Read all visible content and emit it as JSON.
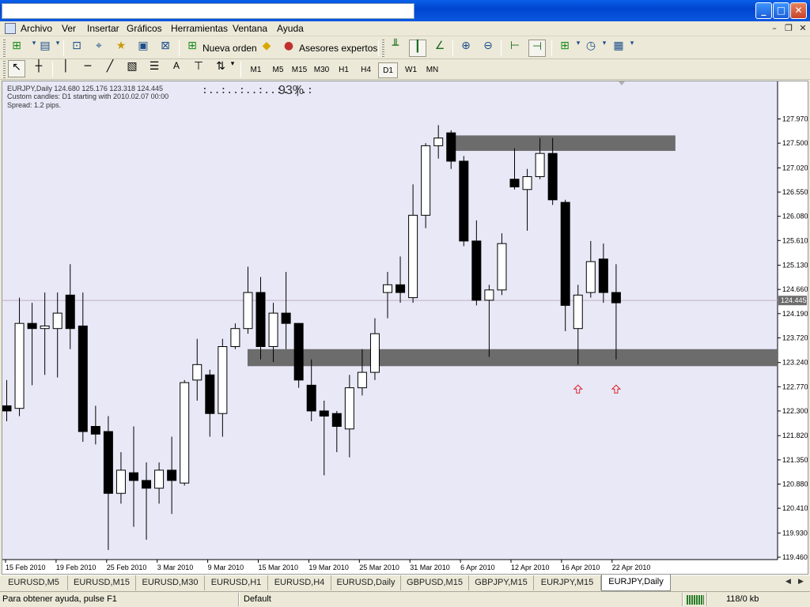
{
  "menu": {
    "items": [
      "Archivo",
      "Ver",
      "Insertar",
      "Gráficos",
      "Herramientas",
      "Ventana",
      "Ayuda"
    ]
  },
  "toolbar": {
    "new_order": "Nueva orden",
    "expert_advisors": "Asesores expertos",
    "timeframes": [
      "M1",
      "M5",
      "M15",
      "M30",
      "H1",
      "H4",
      "D1",
      "W1",
      "MN"
    ],
    "active_timeframe": "D1"
  },
  "chart": {
    "header_line1": "EURJPY,Daily  124.680 125.176 123.318 124.445",
    "header_line2": "Custom candles: D1 starting with 2010.02.07 00:00",
    "header_line3": "Spread:  1.2 pips.",
    "progress_text": ":..:..:..:..:..|.:",
    "progress_percent": "93%",
    "current_price_label": "124.445"
  },
  "chart_data": {
    "type": "candlestick",
    "symbol": "EURJPY",
    "timeframe": "Daily",
    "ylim": [
      119.46,
      128.3
    ],
    "y_ticks": [
      "127.970",
      "127.500",
      "127.020",
      "126.550",
      "126.080",
      "125.610",
      "125.130",
      "124.660",
      "124.190",
      "123.720",
      "123.240",
      "122.770",
      "122.300",
      "121.820",
      "121.350",
      "120.880",
      "120.410",
      "119.930",
      "119.460"
    ],
    "x_tick_labels": [
      "15 Feb 2010",
      "19 Feb 2010",
      "25 Feb 2010",
      "3 Mar 2010",
      "9 Mar 2010",
      "15 Mar 2010",
      "19 Mar 2010",
      "25 Mar 2010",
      "31 Mar 2010",
      "6 Apr 2010",
      "12 Apr 2010",
      "16 Apr 2010",
      "22 Apr 2010"
    ],
    "last_price": 124.445,
    "candles": [
      {
        "o": 122.4,
        "h": 122.9,
        "l": 122.1,
        "c": 122.3
      },
      {
        "o": 122.35,
        "h": 124.5,
        "l": 122.2,
        "c": 124.0
      },
      {
        "o": 124.0,
        "h": 124.4,
        "l": 122.8,
        "c": 123.9
      },
      {
        "o": 123.9,
        "h": 124.6,
        "l": 123.0,
        "c": 123.95
      },
      {
        "o": 123.9,
        "h": 124.6,
        "l": 122.95,
        "c": 124.2
      },
      {
        "o": 124.55,
        "h": 125.15,
        "l": 123.5,
        "c": 123.9
      },
      {
        "o": 123.95,
        "h": 124.6,
        "l": 121.7,
        "c": 121.9
      },
      {
        "o": 122.0,
        "h": 122.4,
        "l": 121.65,
        "c": 121.85
      },
      {
        "o": 121.9,
        "h": 122.2,
        "l": 119.6,
        "c": 120.7
      },
      {
        "o": 120.7,
        "h": 121.5,
        "l": 120.5,
        "c": 121.15
      },
      {
        "o": 121.1,
        "h": 122.0,
        "l": 120.05,
        "c": 120.95
      },
      {
        "o": 120.95,
        "h": 121.3,
        "l": 119.8,
        "c": 120.8
      },
      {
        "o": 120.8,
        "h": 121.3,
        "l": 120.5,
        "c": 121.15
      },
      {
        "o": 121.15,
        "h": 121.8,
        "l": 120.3,
        "c": 120.95
      },
      {
        "o": 120.9,
        "h": 122.9,
        "l": 120.85,
        "c": 122.85
      },
      {
        "o": 122.9,
        "h": 123.7,
        "l": 122.5,
        "c": 123.2
      },
      {
        "o": 123.0,
        "h": 123.1,
        "l": 121.8,
        "c": 122.25
      },
      {
        "o": 122.25,
        "h": 123.7,
        "l": 121.8,
        "c": 123.55
      },
      {
        "o": 123.55,
        "h": 124.0,
        "l": 123.5,
        "c": 123.9
      },
      {
        "o": 123.9,
        "h": 125.1,
        "l": 123.8,
        "c": 124.6
      },
      {
        "o": 124.6,
        "h": 124.9,
        "l": 123.3,
        "c": 123.55
      },
      {
        "o": 123.55,
        "h": 124.4,
        "l": 123.25,
        "c": 124.2
      },
      {
        "o": 124.2,
        "h": 125.0,
        "l": 123.5,
        "c": 124.0
      },
      {
        "o": 124.0,
        "h": 124.0,
        "l": 122.75,
        "c": 122.9
      },
      {
        "o": 122.8,
        "h": 123.3,
        "l": 122.1,
        "c": 122.3
      },
      {
        "o": 122.3,
        "h": 122.5,
        "l": 121.05,
        "c": 122.2
      },
      {
        "o": 122.25,
        "h": 122.3,
        "l": 121.5,
        "c": 122.0
      },
      {
        "o": 121.95,
        "h": 123.0,
        "l": 121.4,
        "c": 122.75
      },
      {
        "o": 122.75,
        "h": 123.5,
        "l": 122.6,
        "c": 123.05
      },
      {
        "o": 123.05,
        "h": 124.1,
        "l": 122.9,
        "c": 123.8
      },
      {
        "o": 124.6,
        "h": 125.0,
        "l": 124.1,
        "c": 124.75
      },
      {
        "o": 124.75,
        "h": 125.3,
        "l": 124.4,
        "c": 124.6
      },
      {
        "o": 124.5,
        "h": 126.7,
        "l": 124.4,
        "c": 126.1
      },
      {
        "o": 126.1,
        "h": 127.5,
        "l": 125.85,
        "c": 127.45
      },
      {
        "o": 127.45,
        "h": 127.85,
        "l": 127.2,
        "c": 127.6
      },
      {
        "o": 127.7,
        "h": 127.75,
        "l": 127.0,
        "c": 127.15
      },
      {
        "o": 127.15,
        "h": 127.25,
        "l": 125.5,
        "c": 125.6
      },
      {
        "o": 125.6,
        "h": 126.0,
        "l": 124.35,
        "c": 124.45
      },
      {
        "o": 124.45,
        "h": 124.75,
        "l": 123.35,
        "c": 124.65
      },
      {
        "o": 124.65,
        "h": 125.75,
        "l": 124.55,
        "c": 125.55
      },
      {
        "o": 126.8,
        "h": 127.4,
        "l": 126.6,
        "c": 126.65
      },
      {
        "o": 126.6,
        "h": 127.0,
        "l": 125.8,
        "c": 126.85
      },
      {
        "o": 126.85,
        "h": 127.6,
        "l": 126.8,
        "c": 127.3
      },
      {
        "o": 127.3,
        "h": 127.6,
        "l": 126.3,
        "c": 126.4
      },
      {
        "o": 126.35,
        "h": 126.4,
        "l": 123.85,
        "c": 124.35
      },
      {
        "o": 123.9,
        "h": 124.75,
        "l": 123.2,
        "c": 124.55
      },
      {
        "o": 124.6,
        "h": 125.6,
        "l": 124.5,
        "c": 125.2
      },
      {
        "o": 125.25,
        "h": 125.55,
        "l": 124.4,
        "c": 124.6
      },
      {
        "o": 124.6,
        "h": 125.15,
        "l": 123.3,
        "c": 124.4
      }
    ],
    "zones": [
      {
        "name": "resistance",
        "top": 127.65,
        "bottom": 127.35
      },
      {
        "name": "support",
        "top": 123.5,
        "bottom": 123.17
      }
    ],
    "arrows": [
      45,
      48
    ]
  },
  "tabs": {
    "items": [
      "EURUSD,M5",
      "EURUSD,M15",
      "EURUSD,M30",
      "EURUSD,H1",
      "EURUSD,H4",
      "EURUSD,Daily",
      "GBPUSD,M15",
      "GBPJPY,M15",
      "EURJPY,M15",
      "EURJPY,Daily"
    ],
    "active": "EURJPY,Daily"
  },
  "status": {
    "help": "Para obtener ayuda, pulse F1",
    "profile": "Default",
    "traffic": "118/0 kb"
  },
  "colors": {
    "chart_bg": "#e8e8f7",
    "zone": "#6c6c6c",
    "arrow": "#e0202a",
    "price_label_bg": "#6d6d6d"
  }
}
